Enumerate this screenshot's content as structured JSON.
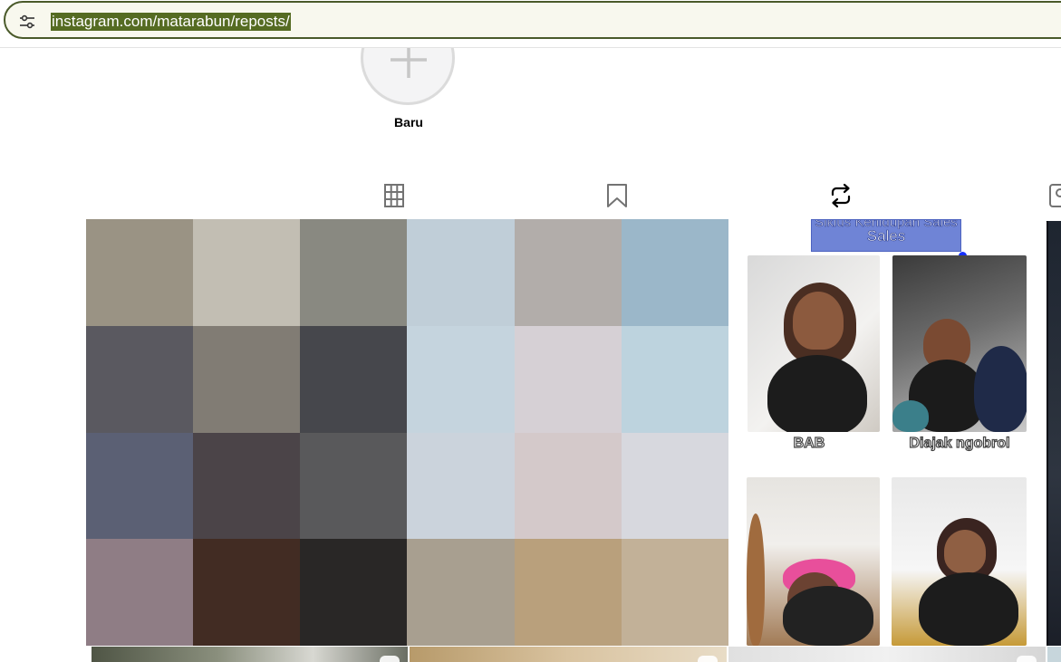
{
  "browser": {
    "url": "instagram.com/matarabun/reposts/",
    "site_settings_icon": "tune-icon"
  },
  "highlights": {
    "new_label": "Baru",
    "new_icon": "plus-icon"
  },
  "tabs": [
    {
      "name": "posts",
      "icon": "grid-icon",
      "active": false
    },
    {
      "name": "saved",
      "icon": "bookmark-icon",
      "active": false
    },
    {
      "name": "reposts",
      "icon": "repost-icon",
      "active": true
    },
    {
      "name": "tagged",
      "icon": "tagged-icon",
      "active": false
    }
  ],
  "grid": {
    "tile1_pixel_colors": [
      "#9a9384",
      "#c2beb3",
      "#898981",
      "#c0ced8",
      "#b2adaa",
      "#9bb7c9",
      "#5a5960",
      "#817c74",
      "#46474c",
      "#c5d4de",
      "#d6d0d5",
      "#bdd3de",
      "#5b6074",
      "#4b4448",
      "#59595b",
      "#cbd3dc",
      "#d4c9ca",
      "#d7d8de",
      "#8f7d85",
      "#422c23",
      "#292726",
      "#a89f90",
      "#b9a07c",
      "#c2b198"
    ],
    "tile2": {
      "banner_text": "Sales",
      "banner_partial": "Siklus Kehidupan Sales",
      "captions": [
        "BAB",
        "Diajak ngobrol"
      ]
    }
  },
  "colors": {
    "tab_active": "#000000",
    "divider": "#dbdbdb",
    "url_highlight": "#556b22"
  }
}
